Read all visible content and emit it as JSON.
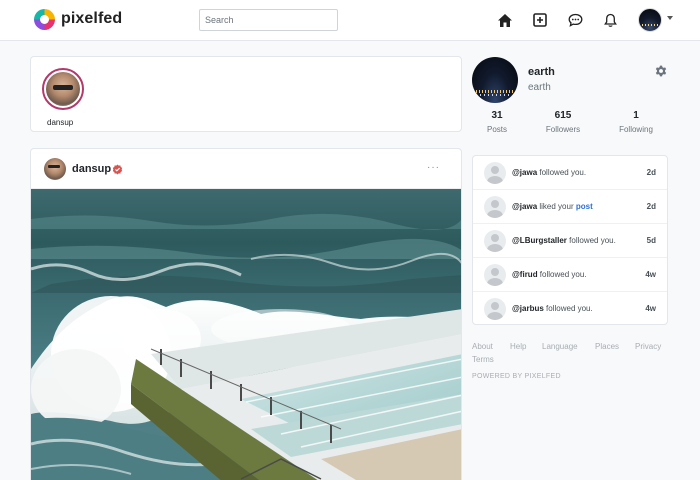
{
  "navbar": {
    "brand": "pixelfed",
    "search_placeholder": "Search",
    "icons": [
      "home-icon",
      "add-post-icon",
      "messages-icon",
      "notifications-icon",
      "user-avatar",
      "chevron-down-icon"
    ]
  },
  "stories": {
    "items": [
      {
        "username": "dansup"
      }
    ]
  },
  "post": {
    "username": "dansup",
    "badge_icon": "verified-badge-icon",
    "more_label": "···"
  },
  "profile": {
    "name": "earth",
    "username": "earth",
    "stats": [
      {
        "value": "31",
        "label": "Posts"
      },
      {
        "value": "615",
        "label": "Followers"
      },
      {
        "value": "1",
        "label": "Following"
      }
    ]
  },
  "notifications": [
    {
      "user": "@jawa",
      "action": " followed you.",
      "link": "",
      "time": "2d"
    },
    {
      "user": "@jawa",
      "action": " liked your ",
      "link": "post",
      "time": "2d"
    },
    {
      "user": "@LBurgstaller",
      "action": " followed you.",
      "link": "",
      "time": "5d"
    },
    {
      "user": "@firud",
      "action": " followed you.",
      "link": "",
      "time": "4w"
    },
    {
      "user": "@jarbus",
      "action": " followed you.",
      "link": "",
      "time": "4w"
    }
  ],
  "footer": {
    "links": [
      "About",
      "Help",
      "Language",
      "Places",
      "Privacy",
      "Terms"
    ],
    "powered": "POWERED BY PIXELFED"
  },
  "colors": {
    "accent": "#2e6fd8",
    "story_ring": "#b3386b",
    "verified": "#d9534f"
  }
}
